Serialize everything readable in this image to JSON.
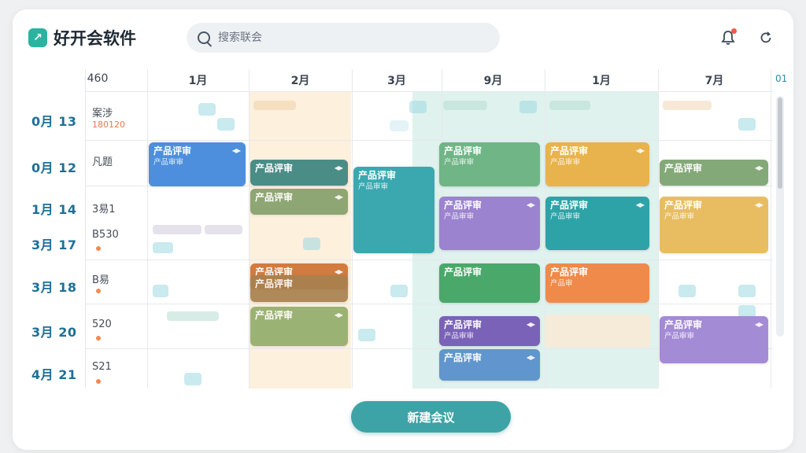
{
  "app": {
    "title": "好开会软件",
    "logo_icon": "arrow-up-right-icon"
  },
  "search": {
    "placeholder": "搜索联会"
  },
  "header_icons": [
    "bell-icon",
    "refresh-icon"
  ],
  "calendar": {
    "corner_label": "460",
    "columns": [
      "1月",
      "2月",
      "3月",
      "9月",
      "1月",
      "7月"
    ],
    "edge_label": "01",
    "rows": [
      {
        "label": "0月 13",
        "sub": "案涉",
        "meta": "180120"
      },
      {
        "label": "0月 12",
        "sub": "凡题"
      },
      {
        "label": "1月 14",
        "sub": "3易1"
      },
      {
        "label": "3月 17",
        "sub": "B530"
      },
      {
        "label": "3月 18",
        "sub": "B易"
      },
      {
        "label": "3月 20",
        "sub": "520"
      },
      {
        "label": "4月 21",
        "sub": "S21"
      }
    ],
    "events": [
      {
        "title": "产品评审",
        "sub": "产品审审",
        "color": "#4d8fdc"
      },
      {
        "title": "产品评审",
        "sub": "",
        "color": "#4a8c86"
      },
      {
        "title": "产品评审",
        "sub": "",
        "color": "#7a9a62"
      },
      {
        "title": "产品评审",
        "sub": "产品审审",
        "color": "#3ba8b0"
      },
      {
        "title": "产品评审",
        "sub": "产品审审",
        "color": "#6fb586"
      },
      {
        "title": "产品评审",
        "sub": "产品审审",
        "color": "#e8b34d"
      },
      {
        "title": "产品评审",
        "sub": "产品审审",
        "color": "#9b83cf"
      },
      {
        "title": "产品评审",
        "sub": "产品审审",
        "color": "#2ea3a7"
      },
      {
        "title": "产品评审",
        "sub": "",
        "color": "#84a978"
      },
      {
        "title": "产品评审",
        "sub": "产品审审",
        "color": "#e6b652"
      },
      {
        "title": "产品评审",
        "sub": "",
        "color": "#d27b3e"
      },
      {
        "title": "产品评审",
        "sub": "",
        "color": "#a8814f"
      },
      {
        "title": "产品评审",
        "sub": "",
        "color": "#8aa864"
      },
      {
        "title": "产品评审",
        "sub": "",
        "color": "#4aa86a"
      },
      {
        "title": "产品评审",
        "sub": "产品审",
        "color": "#ef8a4a"
      },
      {
        "title": "产品评审",
        "sub": "产品审审",
        "color": "#7a62b8"
      },
      {
        "title": "产品评审",
        "sub": "",
        "color": "#4a86c8"
      },
      {
        "title": "产品评审",
        "sub": "产品审审",
        "color": "#a48bd6"
      }
    ]
  },
  "actions": {
    "create_label": "新建会议"
  }
}
